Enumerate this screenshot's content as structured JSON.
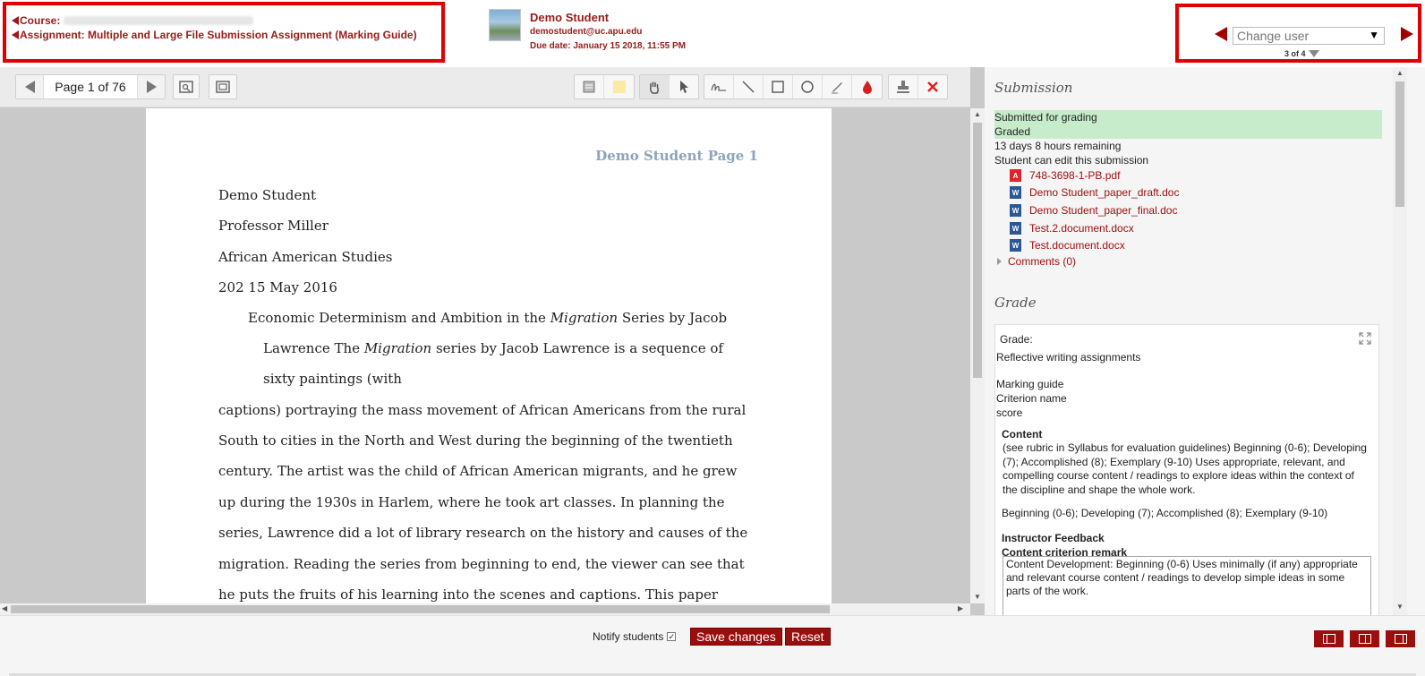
{
  "header": {
    "course_label": "Course:",
    "assignment_label": "Assignment: Multiple and Large File Submission Assignment (Marking Guide)",
    "student_name": "Demo Student",
    "student_email": "demostudent@uc.apu.edu",
    "due_date": "Due date: January 15 2018, 11:55 PM",
    "change_user_placeholder": "Change user",
    "user_count": "3 of 4"
  },
  "pdf": {
    "page_label": "Page 1 of 76",
    "page_header": "Demo Student Page 1",
    "lines": [
      "Demo Student",
      "Professor Miller",
      "African American Studies",
      "202 15 May 2016",
      "sixty paintings (with",
      "captions) portraying the mass movement of African Americans from the rural",
      "South to cities in the North and West during the beginning of the twentieth",
      "century. The artist was the child of African American migrants, and he grew",
      "up during the 1930s in Harlem, where he took art classes. In planning the",
      "series, Lawrence did a lot of library research on the history and causes of the",
      "migration. Reading the series from beginning to end, the viewer can see that",
      "he puts the fruits of his learning into the scenes and captions. This paper"
    ],
    "title_line": {
      "before": "Economic Determinism and Ambition in the ",
      "italic": "Migration",
      "after": " Series by Jacob"
    },
    "second_line": {
      "before": "Lawrence The ",
      "italic": "Migration",
      "after": " series by Jacob Lawrence is a sequence of"
    }
  },
  "submission": {
    "title": "Submission",
    "status_submitted": "Submitted for grading",
    "status_graded": "Graded",
    "time_remaining": "13 days 8 hours remaining",
    "edit_status": "Student can edit this submission",
    "files": [
      {
        "name": "748-3698-1-PB.pdf",
        "type": "pdf-icon"
      },
      {
        "name": "Demo Student_paper_draft.doc",
        "type": "word-icon"
      },
      {
        "name": "Demo Student_paper_final.doc",
        "type": "word-icon"
      },
      {
        "name": "Test.2.document.docx",
        "type": "word-icon"
      },
      {
        "name": "Test.document.docx",
        "type": "word-icon"
      }
    ],
    "comments": "Comments (0)"
  },
  "grade": {
    "title": "Grade",
    "grade_label": "Grade:",
    "assessment_type": "Reflective writing assignments",
    "marking_guide": "Marking guide",
    "criterion_name": "Criterion name",
    "score": "score",
    "content_title": "Content",
    "content_description": "(see rubric in Syllabus for evaluation guidelines) Beginning (0-6); Developing (7); Accomplished (8); Exemplary (9-10) Uses appropriate, relevant, and compelling course content / readings to explore ideas within the context of the discipline and shape the whole work.",
    "content_levels": "Beginning (0-6); Developing (7); Accomplished (8); Exemplary (9-10)",
    "instructor_feedback": "Instructor Feedback",
    "remark_label": "Content criterion remark",
    "remark_text": "Content Development: Beginning (0-6) Uses minimally (if any) appropriate and relevant course content / readings to develop simple ideas in some parts of the work."
  },
  "footer": {
    "notify_label": "Notify students",
    "save_label": "Save changes",
    "reset_label": "Reset"
  },
  "colors": {
    "accent": "#9a0e0e",
    "highlight_red": "#e00000",
    "status_green": "#c7eccb"
  }
}
